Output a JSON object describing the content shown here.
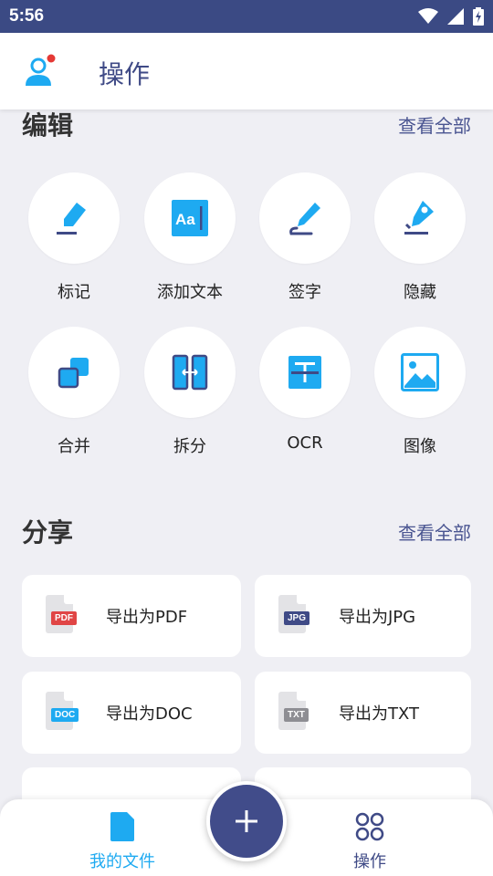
{
  "status": {
    "time": "5:56"
  },
  "appbar": {
    "title": "操作",
    "avatar_icon": "user-avatar-icon"
  },
  "edit": {
    "title": "编辑",
    "see_all": "查看全部",
    "tools": [
      {
        "label": "标记",
        "icon": "highlighter-icon"
      },
      {
        "label": "添加文本",
        "icon": "add-text-icon"
      },
      {
        "label": "签字",
        "icon": "signature-pen-icon"
      },
      {
        "label": "隐藏",
        "icon": "redact-icon"
      },
      {
        "label": "合并",
        "icon": "merge-icon"
      },
      {
        "label": "拆分",
        "icon": "split-icon"
      },
      {
        "label": "OCR",
        "icon": "ocr-icon"
      },
      {
        "label": "图像",
        "icon": "image-icon"
      }
    ]
  },
  "share": {
    "title": "分享",
    "see_all": "查看全部",
    "cards": [
      {
        "label": "导出为PDF",
        "tag": "PDF",
        "tag_color": "#e04545"
      },
      {
        "label": "导出为JPG",
        "tag": "JPG",
        "tag_color": "#3f4a86"
      },
      {
        "label": "导出为DOC",
        "tag": "DOC",
        "tag_color": "#1eaaf1"
      },
      {
        "label": "导出为TXT",
        "tag": "TXT",
        "tag_color": "#8e8e93"
      }
    ]
  },
  "bottom_nav": {
    "my_files": "我的文件",
    "actions": "操作",
    "fab_icon": "plus-icon"
  },
  "colors": {
    "accent": "#1eaaf1",
    "primary": "#3f4a86",
    "background": "#efeff4"
  }
}
